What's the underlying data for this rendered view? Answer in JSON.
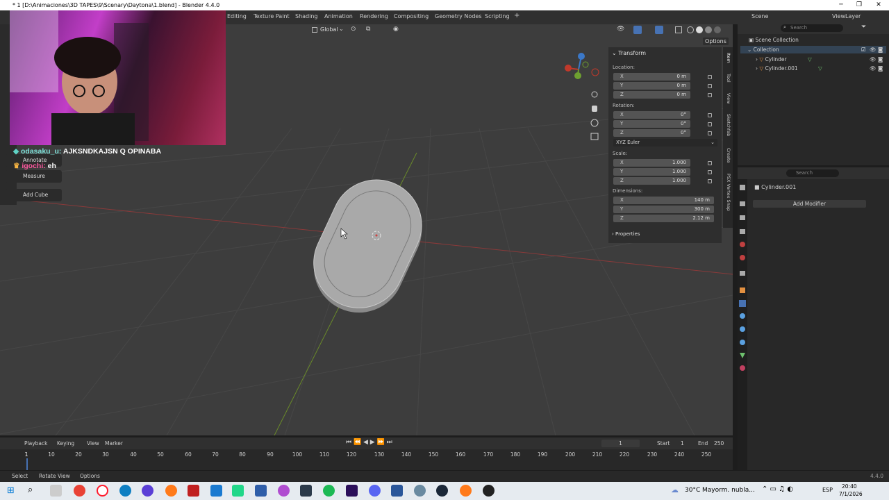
{
  "window": {
    "title": "* 1 [D:\\Animaciones\\3D TAPES\\9\\Scenary\\Daytona\\1.blend] - Blender 4.4.0",
    "min": "─",
    "max": "❐",
    "close": "✕"
  },
  "workspaces": [
    "Editing",
    "Texture Paint",
    "Shading",
    "Animation",
    "Rendering",
    "Compositing",
    "Geometry Nodes",
    "Scripting",
    "+"
  ],
  "scene": {
    "label": "Scene",
    "viewlayer": "ViewLayer"
  },
  "viewport": {
    "orientation": "Global",
    "options": "Options"
  },
  "chat": {
    "line1_user": "odasaku_u:",
    "line1_msg": " AJKSNDKAJSN Q OPINABA",
    "line2_user": "igochi:",
    "line2_msg": " eh"
  },
  "tools": {
    "annotate": "Annotate",
    "measure": "Measure",
    "add_cube": "Add Cube"
  },
  "npanel": {
    "header": "Transform",
    "location_label": "Location:",
    "location": [
      {
        "axis": "X",
        "value": "0 m"
      },
      {
        "axis": "Y",
        "value": "0 m"
      },
      {
        "axis": "Z",
        "value": "0 m"
      }
    ],
    "rotation_label": "Rotation:",
    "rotation": [
      {
        "axis": "X",
        "value": "0°"
      },
      {
        "axis": "Y",
        "value": "0°"
      },
      {
        "axis": "Z",
        "value": "0°"
      }
    ],
    "rotation_mode": "XYZ Euler",
    "scale_label": "Scale:",
    "scale": [
      {
        "axis": "X",
        "value": "1.000"
      },
      {
        "axis": "Y",
        "value": "1.000"
      },
      {
        "axis": "Z",
        "value": "1.000"
      }
    ],
    "dimensions_label": "Dimensions:",
    "dimensions": [
      {
        "axis": "X",
        "value": "140 m"
      },
      {
        "axis": "Y",
        "value": "300 m"
      },
      {
        "axis": "Z",
        "value": "2.12 m"
      }
    ],
    "properties": "Properties",
    "tabs": [
      "Item",
      "Tool",
      "View",
      "Sketchfab",
      "Create",
      "PSX Vertex Snap"
    ]
  },
  "outliner": {
    "search": "Search",
    "scene_collection": "Scene Collection",
    "collection": "Collection",
    "items": [
      "Cylinder",
      "Cylinder.001"
    ]
  },
  "properties_editor": {
    "search": "Search",
    "object": "Cylinder.001",
    "add_modifier": "Add Modifier"
  },
  "timeline": {
    "menus": [
      "Playback",
      "Keying",
      "View",
      "Marker"
    ],
    "current_frame": "1",
    "start_label": "Start",
    "start": "1",
    "end_label": "End",
    "end": "250",
    "ticks": [
      "1",
      "10",
      "20",
      "30",
      "40",
      "50",
      "60",
      "70",
      "80",
      "90",
      "100",
      "110",
      "120",
      "130",
      "140",
      "150",
      "160",
      "170",
      "180",
      "190",
      "200",
      "210",
      "220",
      "230",
      "240",
      "250"
    ]
  },
  "statusbar": {
    "select": "Select",
    "rotate": "Rotate View",
    "options": "Options",
    "version": "4.4.0"
  },
  "taskbar": {
    "weather": "30°C",
    "weather_desc": "Mayorm. nubla...",
    "lang": "ESP",
    "time": "20:40",
    "date": "7/1/2026"
  },
  "colors": {
    "accent": "#4772b3",
    "axis_x": "#c0392b",
    "axis_y": "#6ea030",
    "axis_z": "#3b78c8"
  }
}
